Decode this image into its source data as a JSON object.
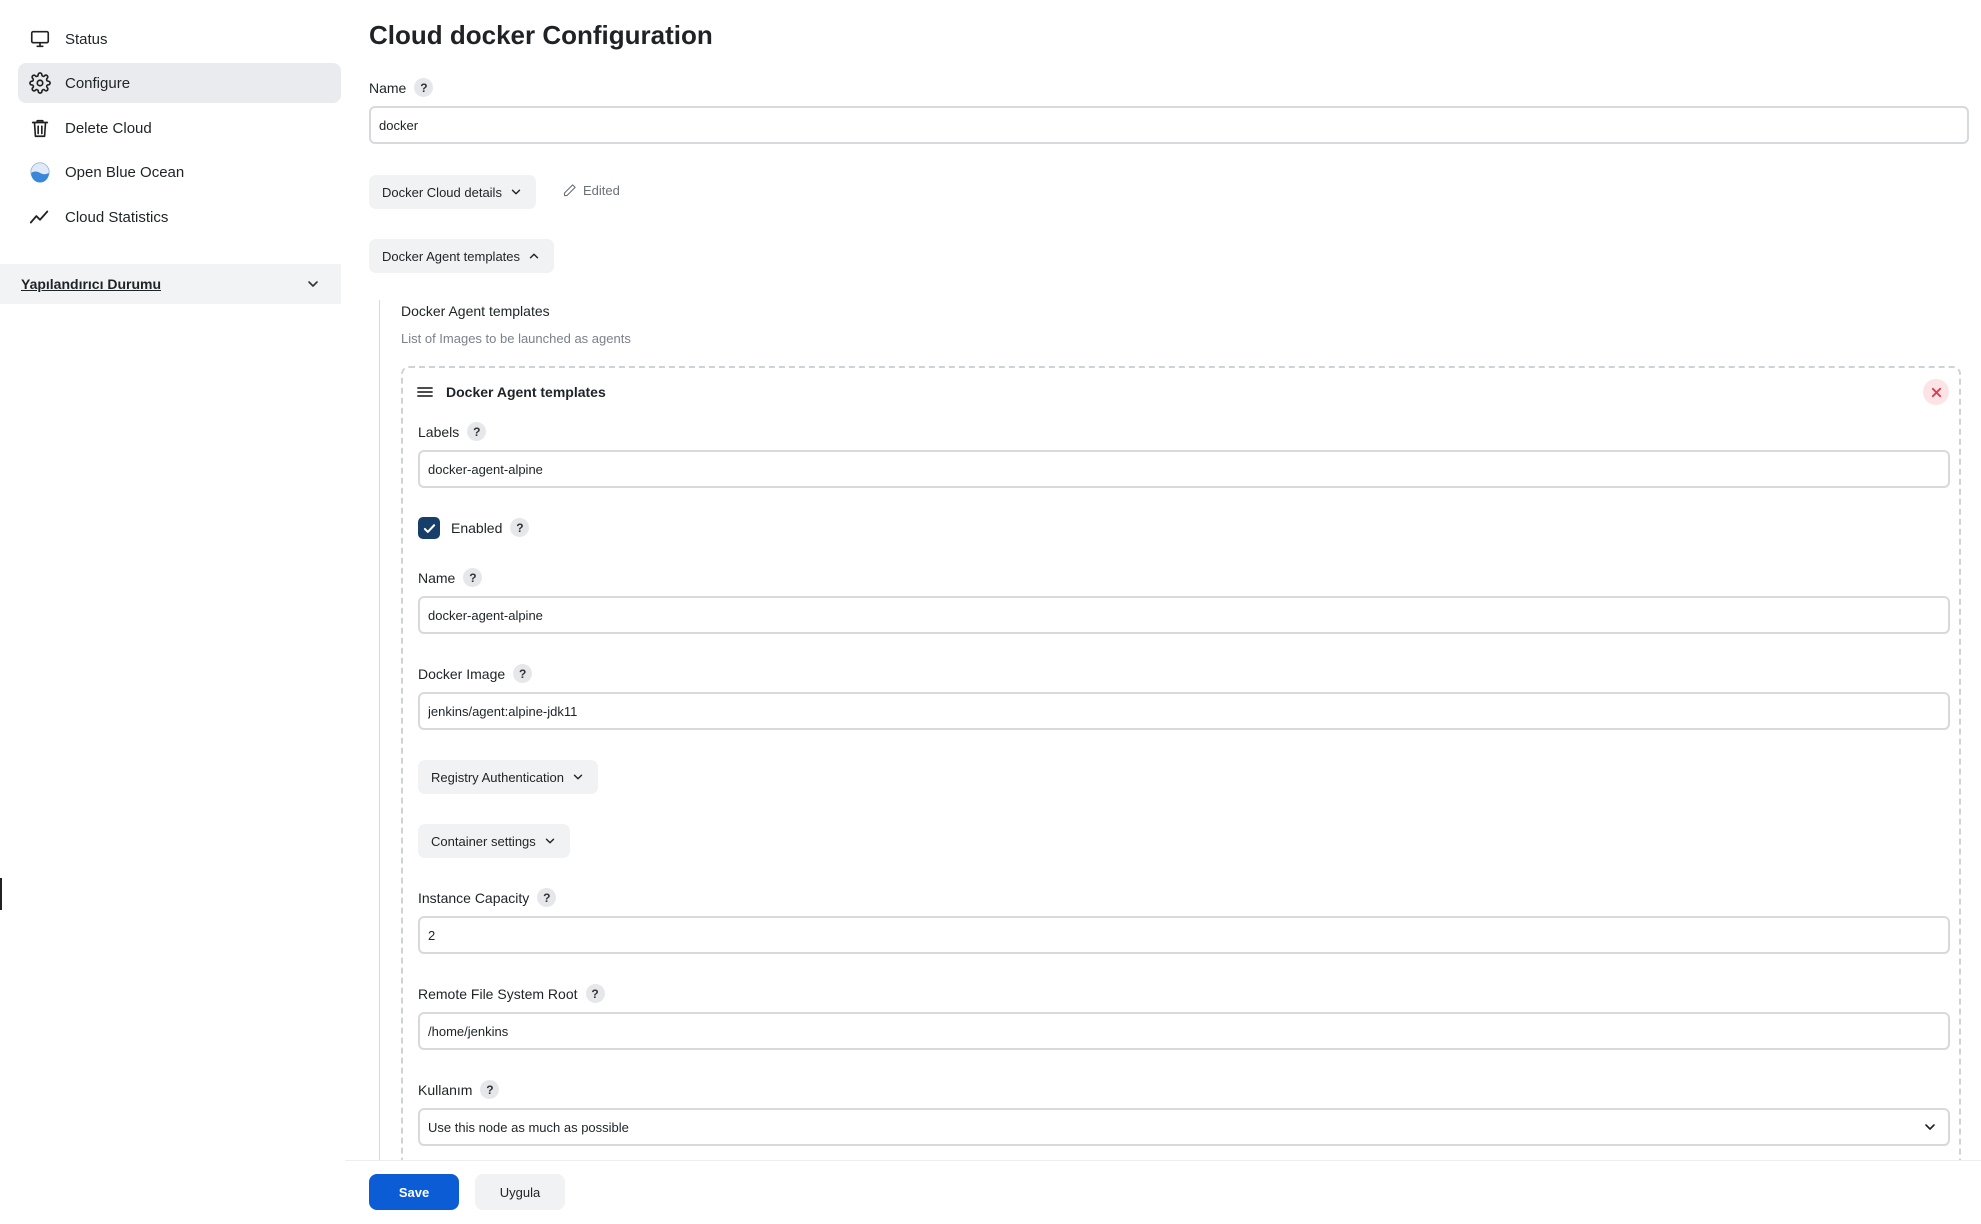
{
  "sidebar": {
    "items": [
      {
        "label": "Status",
        "icon": "monitor-icon"
      },
      {
        "label": "Configure",
        "icon": "gear-icon",
        "active": true
      },
      {
        "label": "Delete Cloud",
        "icon": "trash-icon"
      },
      {
        "label": "Open Blue Ocean",
        "icon": "blue-ocean-icon"
      },
      {
        "label": "Cloud Statistics",
        "icon": "line-chart-icon"
      }
    ],
    "section": {
      "label": "Yapılandırıcı Durumu",
      "icon": "chevron-down-icon"
    }
  },
  "page": {
    "title": "Cloud docker Configuration",
    "name_label": "Name",
    "name_value": "docker",
    "docker_cloud_details_label": "Docker Cloud details",
    "edited_label": "Edited",
    "agent_templates_toggle_label": "Docker Agent templates",
    "templates_section_title": "Docker Agent templates",
    "templates_section_desc": "List of Images to be launched as agents"
  },
  "template": {
    "header": "Docker Agent templates",
    "labels_label": "Labels",
    "labels_value": "docker-agent-alpine",
    "enabled_label": "Enabled",
    "enabled": true,
    "name_label": "Name",
    "name_value": "docker-agent-alpine",
    "image_label": "Docker Image",
    "image_value": "jenkins/agent:alpine-jdk11",
    "registry_auth_label": "Registry Authentication",
    "container_settings_label": "Container settings",
    "capacity_label": "Instance Capacity",
    "capacity_value": "2",
    "fs_root_label": "Remote File System Root",
    "fs_root_value": "/home/jenkins",
    "usage_label": "Kullanım",
    "usage_value": "Use this node as much as possible"
  },
  "help_glyph": "?",
  "actions": {
    "save_label": "Save",
    "apply_label": "Uygula"
  },
  "colors": {
    "primary": "#0b5cd5",
    "checkbox": "#163e69",
    "delete": "#e5384e"
  }
}
